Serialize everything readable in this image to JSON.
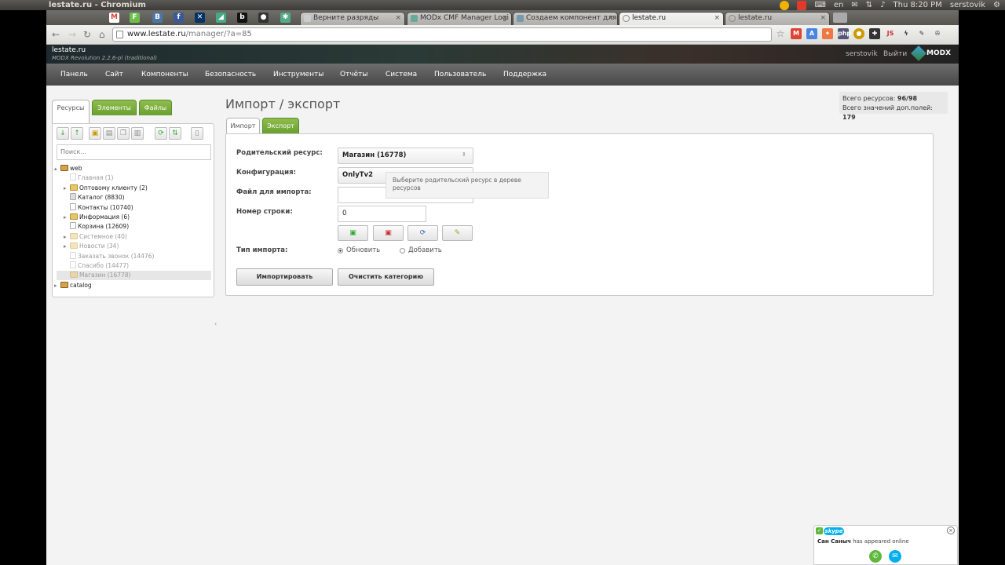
{
  "system": {
    "window_title": "lestate.ru - Chromium",
    "lang": "en",
    "clock": "Thu 8:20 PM",
    "user": "serstovik"
  },
  "browser": {
    "tabs": [
      {
        "label": "Верните разряды",
        "active": false
      },
      {
        "label": "MODx CMF Manager Logi",
        "active": false
      },
      {
        "label": "Создаем компонент для",
        "active": false
      },
      {
        "label": "lestate.ru",
        "active": true
      },
      {
        "label": "lestate.ru",
        "active": false
      }
    ],
    "pinned": [
      "gmail-icon",
      "feedly-icon",
      "vk-icon",
      "facebook-icon",
      "xing-icon",
      "tool-icon",
      "b-icon",
      "github-icon",
      "bug-icon"
    ],
    "url_host": "www.lestate.ru",
    "url_path": "/manager/?a=85",
    "extensions": [
      "star-icon",
      "gmail-icon",
      "translate-icon",
      "puzzle-icon",
      "php-icon",
      "chrome-icon",
      "plug-icon",
      "js-icon",
      "lightning-icon",
      "pencil-icon",
      "wrench-icon"
    ]
  },
  "modx": {
    "site_name": "lestate.ru",
    "version": "MODX Revolution 2.2.6-pl (traditional)",
    "user": "serstovik",
    "logout": "Выйти",
    "logo": "MODX",
    "menu": [
      "Панель",
      "Сайт",
      "Компоненты",
      "Безопасность",
      "Инструменты",
      "Отчёты",
      "Система",
      "Пользователь",
      "Поддержка"
    ]
  },
  "left": {
    "tabs": [
      "Ресурсы",
      "Элементы",
      "Файлы"
    ],
    "search_placeholder": "Поиск...",
    "tree": [
      {
        "label": "web",
        "level": 0,
        "icon": "home",
        "arrow": "▴",
        "muted": false
      },
      {
        "label": "Главная  (1)",
        "level": 1,
        "icon": "page",
        "arrow": "",
        "muted": true
      },
      {
        "label": "Оптовому клиенту  (2)",
        "level": 1,
        "icon": "folder",
        "arrow": "▸",
        "muted": false
      },
      {
        "label": "Каталог  (8830)",
        "level": 1,
        "icon": "page",
        "arrow": "",
        "muted": false
      },
      {
        "label": "Контакты  (10740)",
        "level": 1,
        "icon": "page",
        "arrow": "",
        "muted": false
      },
      {
        "label": "Информация  (6)",
        "level": 1,
        "icon": "folder",
        "arrow": "▸",
        "muted": false
      },
      {
        "label": "Корзина  (12609)",
        "level": 1,
        "icon": "page",
        "arrow": "",
        "muted": false
      },
      {
        "label": "Системное  (40)",
        "level": 1,
        "icon": "folder",
        "arrow": "▸",
        "muted": true
      },
      {
        "label": "Новости  (34)",
        "level": 1,
        "icon": "folder",
        "arrow": "▸",
        "muted": true
      },
      {
        "label": "Заказать звонок  (14476)",
        "level": 1,
        "icon": "page",
        "arrow": "",
        "muted": true
      },
      {
        "label": "Спасибо  (14477)",
        "level": 1,
        "icon": "page",
        "arrow": "",
        "muted": true
      },
      {
        "label": "Магазин  (16778)",
        "level": 1,
        "icon": "folder",
        "arrow": "",
        "muted": true
      },
      {
        "label": "catalog",
        "level": 0,
        "icon": "home",
        "arrow": "▸",
        "muted": false
      }
    ]
  },
  "main": {
    "title": "Импорт / экспорт",
    "stats": {
      "resources_label": "Всего ресурсов:",
      "resources_value": "96/98",
      "tv_label": "Всего значений доп.полей:",
      "tv_value": "179"
    },
    "tabs": [
      "Импорт",
      "Экспорт"
    ],
    "form": {
      "parent_label": "Родительский ресурс:",
      "parent_value": "Магазин (16778)",
      "config_label": "Конфигурация:",
      "config_value": "OnlyTv2",
      "file_label": "Файл для импорта:",
      "file_value": "",
      "row_label": "Номер строки:",
      "row_value": "0",
      "type_label": "Тип импорта:",
      "type_options": [
        "Обновить",
        "Добавить"
      ],
      "type_selected": "Обновить",
      "tooltip": "Выберите родительский ресурс в дереве ресурсов",
      "import_button": "Импортировать",
      "clear_button": "Очистить категорию"
    }
  },
  "skype": {
    "brand": "skype",
    "name": "Сан Саныч",
    "message": "has appeared online"
  }
}
